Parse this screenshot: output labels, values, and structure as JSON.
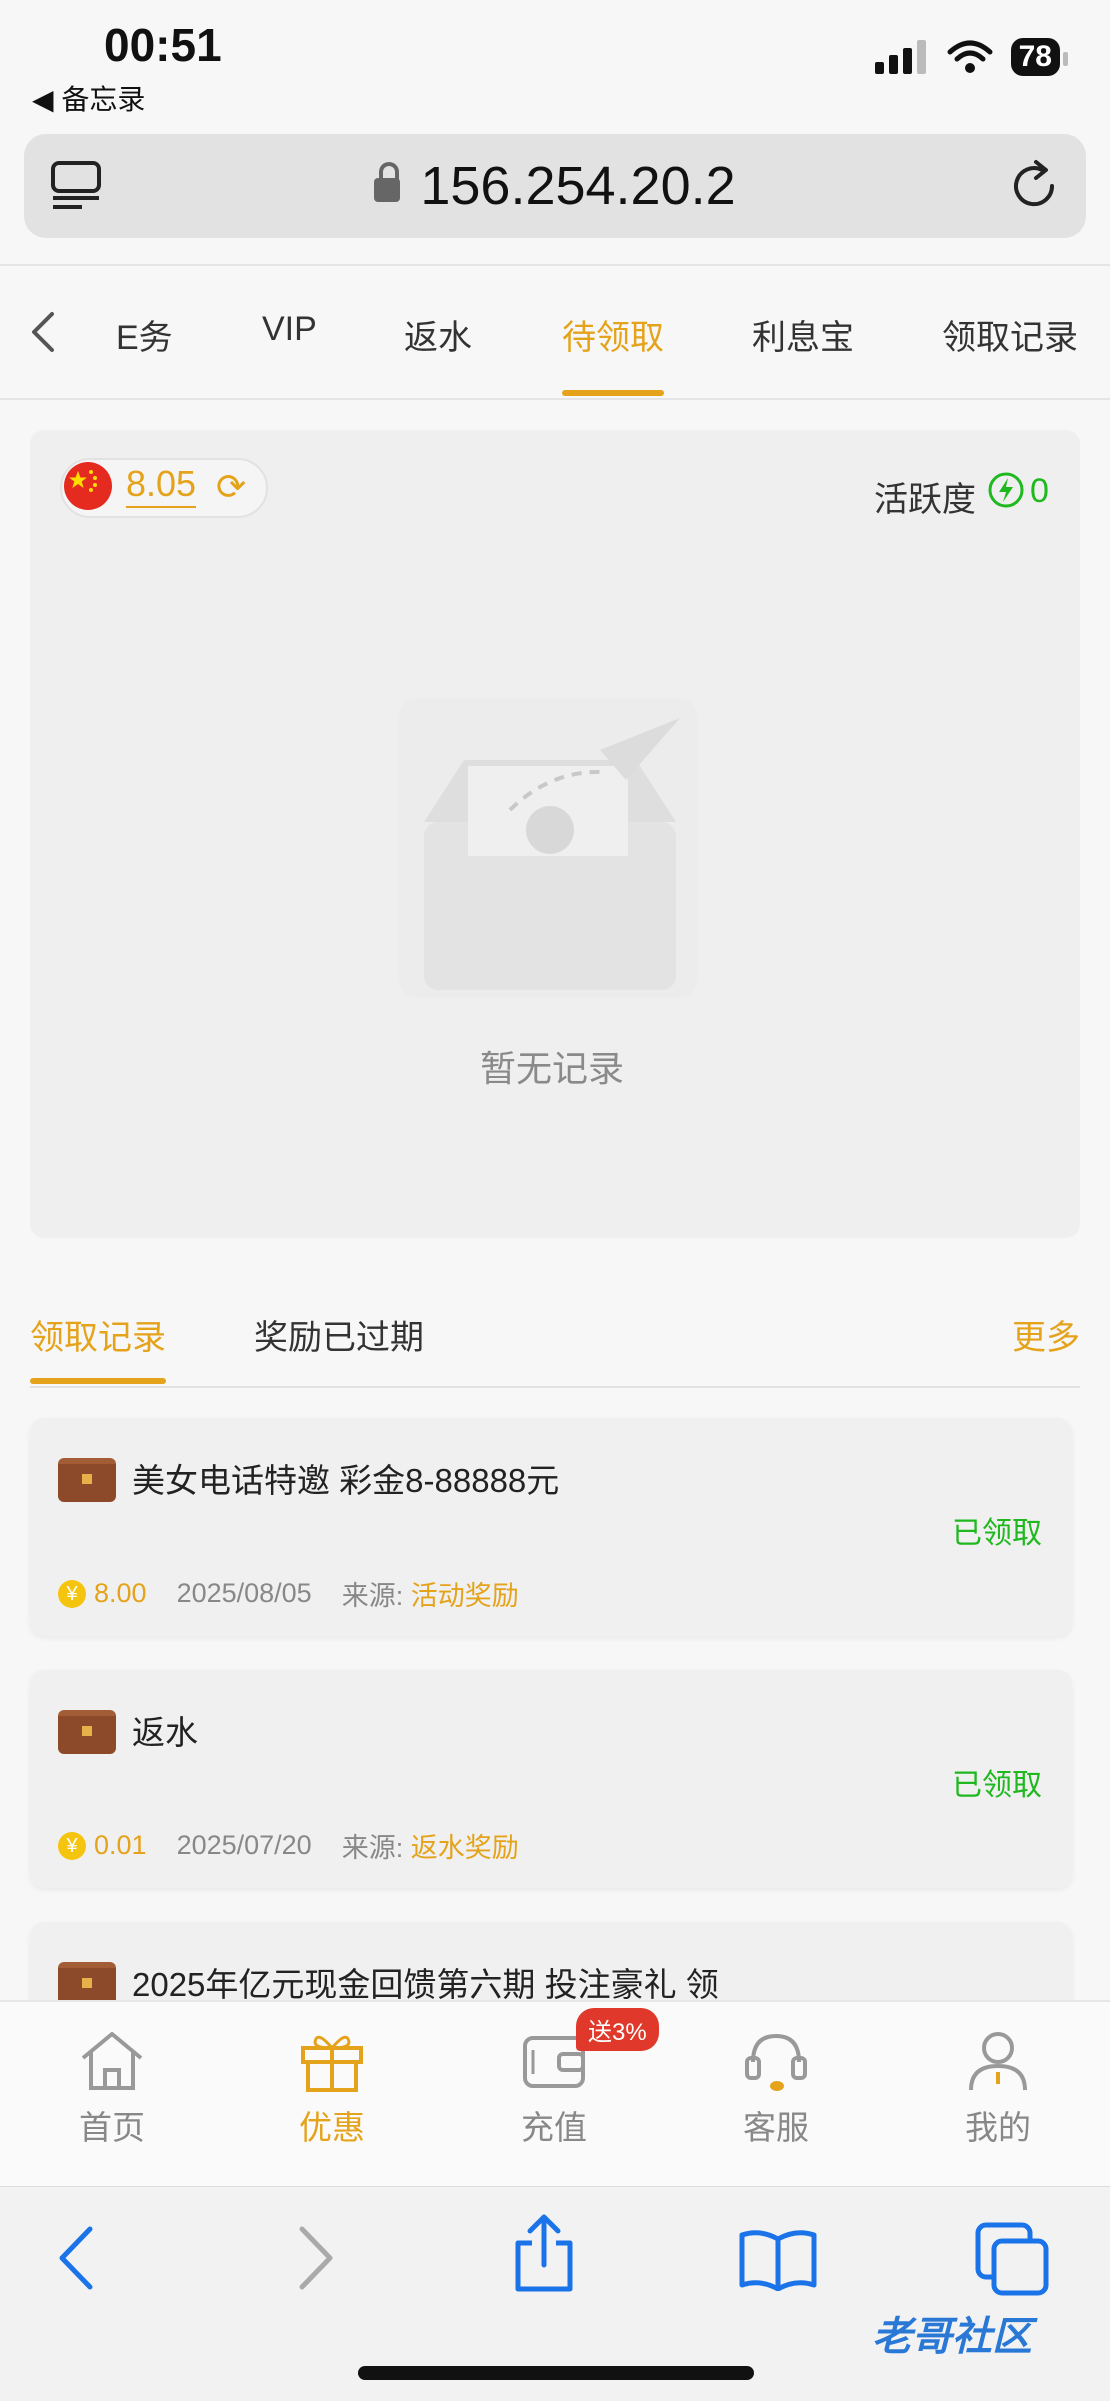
{
  "status_bar": {
    "time": "00:51",
    "back_label": "◀ 备忘录",
    "battery": "78"
  },
  "url_bar": {
    "url": "156.254.20.2"
  },
  "top_tabs": [
    "E务",
    "VIP",
    "返水",
    "待领取",
    "利息宝",
    "领取记录"
  ],
  "active_top_tab": "待领取",
  "balance": {
    "amount": "8.05"
  },
  "activity": {
    "label": "活跃度",
    "value": "0"
  },
  "empty": {
    "text": "暂无记录"
  },
  "section_tabs": {
    "tab1": "领取记录",
    "tab2": "奖励已过期",
    "more": "更多"
  },
  "records": [
    {
      "title": "美女电话特邀 彩金8-88888元",
      "status": "已领取",
      "amount": "8.00",
      "date": "2025/08/05",
      "source_label": "来源:",
      "source": "活动奖励"
    },
    {
      "title": "返水",
      "status": "已领取",
      "amount": "0.01",
      "date": "2025/07/20",
      "source_label": "来源:",
      "source": "返水奖励"
    },
    {
      "title": "2025年亿元现金回馈第六期 投注豪礼 领"
    }
  ],
  "bottom_nav": {
    "home": "首页",
    "promo": "优惠",
    "recharge": "充值",
    "service": "客服",
    "mine": "我的",
    "badge": "送3%"
  },
  "watermark": "老哥社区",
  "colors": {
    "accent": "#e4a31b",
    "success": "#1fb81f",
    "badge": "#e0382a",
    "link_blue": "#2a78d6"
  }
}
